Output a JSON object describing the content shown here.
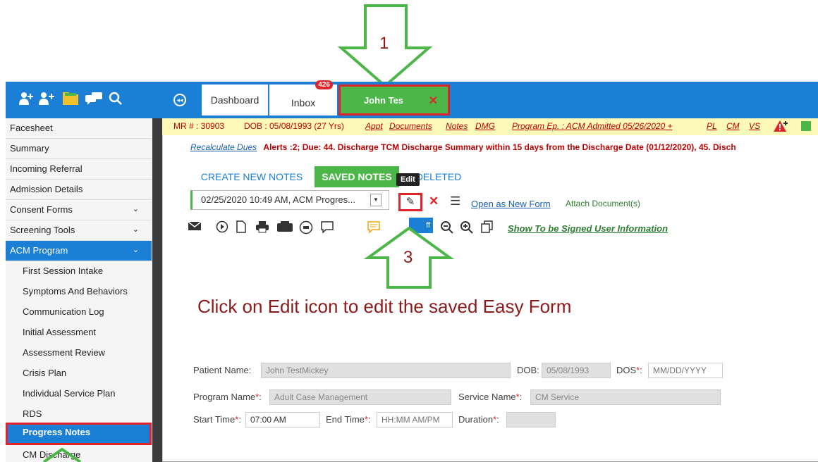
{
  "colors": {
    "brand_blue": "#1c7fd6",
    "green": "#4cb648",
    "red": "#e0242a",
    "callout": "#8b1a1a"
  },
  "callouts": {
    "one": "1",
    "three": "3",
    "instruction": "Click on Edit icon to edit the saved Easy Form"
  },
  "top_icons": [
    "add-user-icon",
    "add-users-icon",
    "folder-icon",
    "chat-icon",
    "search-icon"
  ],
  "tabs": {
    "dashboard": "Dashboard",
    "inbox": "Inbox",
    "inbox_badge": "426",
    "patient": "John Tes"
  },
  "info_bar": {
    "mr": "MR # : 30903",
    "dob": "DOB : 05/08/1993 (27 Yrs)",
    "appt": "Appt",
    "documents": "Documents",
    "notes": "Notes",
    "dmg": "DMG",
    "program": "Program Ep. : ACM Admitted 05/26/2020 +",
    "pl": "PL",
    "cm": "CM",
    "vs": "VS"
  },
  "alerts": {
    "recalc": "Recalculate Dues",
    "text": "Alerts :2;   Due: 44. Discharge TCM Discharge Summary within 15 days from the Discharge Date (01/12/2020),   45. Disch"
  },
  "sidebar": {
    "items": [
      {
        "label": "Facesheet"
      },
      {
        "label": "Summary"
      },
      {
        "label": "Incoming Referral"
      },
      {
        "label": "Admission Details"
      },
      {
        "label": "Consent Forms",
        "chevron": "⌄"
      },
      {
        "label": "Screening Tools",
        "chevron": "⌄"
      },
      {
        "label": "ACM Program",
        "chevron": "⌄"
      }
    ],
    "sub_items": [
      "First Session Intake",
      "Symptoms And Behaviors",
      "Communication Log",
      "Initial Assessment",
      "Assessment Review",
      "Crisis Plan",
      "Individual Service Plan",
      "RDS",
      "Progress Notes",
      "CM Discharge"
    ]
  },
  "note_tabs": {
    "create": "CREATE NEW NOTES",
    "saved": "SAVED NOTES",
    "deleted": "DELETED"
  },
  "note_toolbar": {
    "selected_note": "02/25/2020 10:49 AM, ACM Progres...",
    "edit_tooltip": "Edit",
    "open_new": "Open as New Form",
    "attach": "Attach Document(s)",
    "show_signed": "Show To be Signed User Information",
    "blue_btn": "ff"
  },
  "form": {
    "patient_name_label": "Patient Name:",
    "patient_name": "John TestMickey",
    "dob_label": "DOB:",
    "dob": "05/08/1993",
    "dos_label": "DOS",
    "dos_placeholder": "MM/DD/YYYY",
    "program_label": "Program Name",
    "program": "Adult Case Management",
    "service_label": "Service Name",
    "service": "CM Service",
    "start_label": "Start Time",
    "start": "07:00 AM",
    "end_label": "End Time",
    "end_placeholder": "HH:MM AM/PM",
    "duration_label": "Duration",
    "req_mark": "*",
    "colon": ":"
  }
}
